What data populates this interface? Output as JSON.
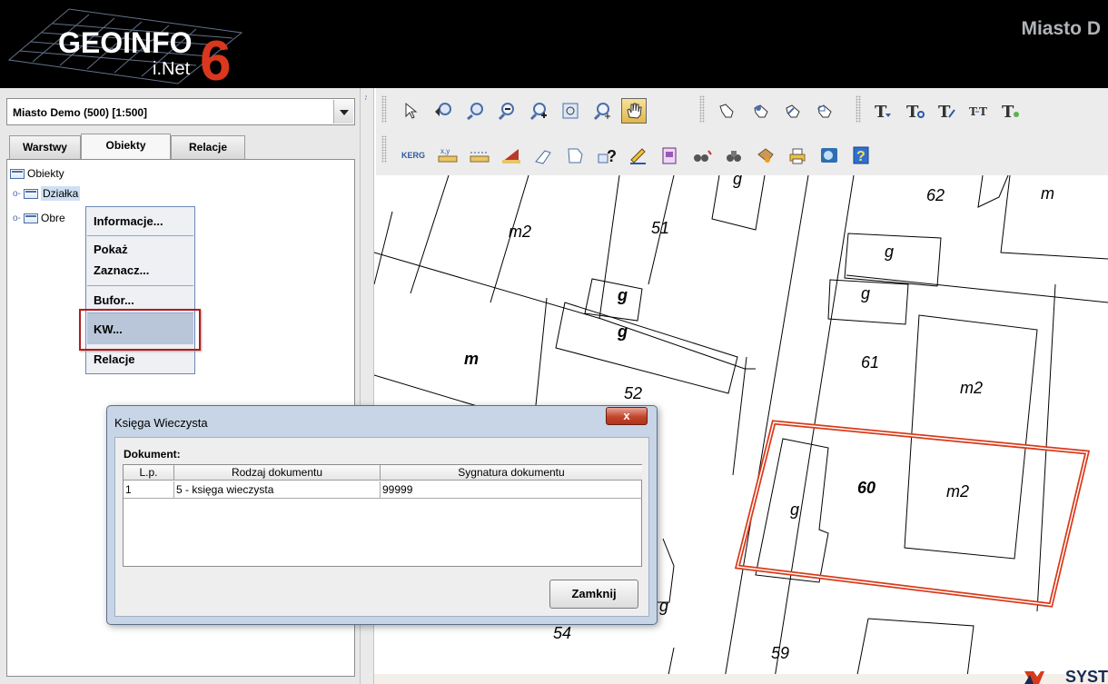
{
  "app": {
    "logo_word": "GEOINFO",
    "logo_sub": "i.Net",
    "logo_num": "6",
    "header_title": "Miasto D"
  },
  "left_panel": {
    "scale_combo": "Miasto Demo (500) [1:500]",
    "tabs": [
      "Warstwy",
      "Obiekty",
      "Relacje"
    ],
    "active_tab": "Obiekty",
    "tree": {
      "root": "Obiekty",
      "items": [
        "Działka",
        "Obre"
      ]
    }
  },
  "context_menu": {
    "items": [
      "Informacje...",
      "Pokaż",
      "Zaznacz...",
      "Bufor...",
      "KW...",
      "Relacje"
    ],
    "highlighted": "KW..."
  },
  "toolbar": {
    "row1_icons": [
      "select-arrow-icon",
      "zoom-region-in-icon",
      "zoom-region-out-icon",
      "zoom-out-icon",
      "zoom-in-icon",
      "zoom-window-icon",
      "zoom-center-icon",
      "pan-hand-icon",
      "hand-point-icon",
      "hand-select-icon",
      "hand-select-2-icon",
      "hand-select-3-icon",
      "text-t1-icon",
      "text-t2-icon",
      "text-t3-icon",
      "text-t4-icon",
      "text-t5-icon"
    ],
    "row2_icons": [
      "kerg-icon",
      "xy-ruler-icon",
      "ruler-icon",
      "angle-icon",
      "shape-icon",
      "polygon-icon",
      "query-icon",
      "pencil-icon",
      "jpg-icon",
      "binoculars-icon",
      "binoculars-2-icon",
      "color-icon",
      "print-icon",
      "globe-icon",
      "help-icon"
    ],
    "kerg_label": "KERG",
    "xy_label": "x,y"
  },
  "map": {
    "labels": [
      "m",
      "g",
      "62",
      "m2",
      "51",
      "g",
      "g",
      "g",
      "g",
      "m",
      "61",
      "m2",
      "52",
      "60",
      "m2",
      "g",
      "g",
      "54",
      "59",
      "g"
    ]
  },
  "dialog": {
    "title": "Księga Wieczysta",
    "section_label": "Dokument:",
    "columns": [
      "L.p.",
      "Rodzaj dokumentu",
      "Sygnatura dokumentu"
    ],
    "rows": [
      [
        "1",
        "5 - księga wieczysta",
        "99999"
      ]
    ],
    "close_button": "Zamknij",
    "close_x": "x"
  },
  "footer": {
    "brand": "SYST"
  }
}
